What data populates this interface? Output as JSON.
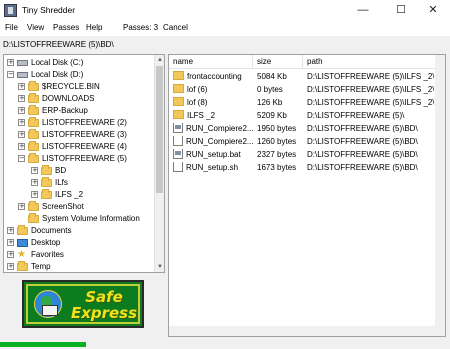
{
  "window": {
    "title": "Tiny Shredder",
    "minimize": "—",
    "maximize": "☐",
    "close": "✕"
  },
  "menu": {
    "file": "File",
    "view": "View",
    "passes": "Passes",
    "help": "Help",
    "passes_count": "Passes: 3",
    "cancel": "Cancel"
  },
  "current_path": "D:\\LISTOFFREEWARE (5)\\BD\\",
  "tree": [
    {
      "label": "Local Disk (C:)",
      "icon": "drive-icon",
      "expander": "+"
    },
    {
      "label": "Local Disk (D:)",
      "icon": "drive-icon",
      "expander": "−"
    },
    {
      "label": "$RECYCLE.BIN",
      "icon": "folder-icon",
      "expander": "+"
    },
    {
      "label": "DOWNLOADS",
      "icon": "folder-icon",
      "expander": "+"
    },
    {
      "label": "ERP-Backup",
      "icon": "folder-icon",
      "expander": "+"
    },
    {
      "label": "LISTOFFREEWARE (2)",
      "icon": "folder-icon",
      "expander": "+"
    },
    {
      "label": "LISTOFFREEWARE (3)",
      "icon": "folder-icon",
      "expander": "+"
    },
    {
      "label": "LISTOFFREEWARE (4)",
      "icon": "folder-icon",
      "expander": "+"
    },
    {
      "label": "LISTOFFREEWARE (5)",
      "icon": "folder-icon",
      "expander": "−"
    },
    {
      "label": "BD",
      "icon": "folder-icon",
      "expander": "+"
    },
    {
      "label": "ILfs",
      "icon": "folder-icon",
      "expander": "+"
    },
    {
      "label": "ILFS _2",
      "icon": "folder-icon",
      "expander": "+"
    },
    {
      "label": "ScreenShot",
      "icon": "folder-icon",
      "expander": "+"
    },
    {
      "label": "System Volume Information",
      "icon": "folder-icon",
      "expander": ""
    },
    {
      "label": "Documents",
      "icon": "folder-icon",
      "expander": "+"
    },
    {
      "label": "Desktop",
      "icon": "desktop-icon",
      "expander": "+"
    },
    {
      "label": "Favorites",
      "icon": "star-icon",
      "expander": "+"
    },
    {
      "label": "Temp",
      "icon": "folder-icon",
      "expander": "+"
    }
  ],
  "logo": {
    "line1": "Safe",
    "line2": "Express"
  },
  "columns": {
    "name": "name",
    "size": "size",
    "path": "path"
  },
  "files": [
    {
      "name": "frontaccounting",
      "size": "5084 Kb",
      "path": "D:\\LISTOFFREEWARE (5)\\ILFS _2\\",
      "type": "folder"
    },
    {
      "name": "lof (6)",
      "size": "0 bytes",
      "path": "D:\\LISTOFFREEWARE (5)\\ILFS _2\\",
      "type": "folder"
    },
    {
      "name": "lof (8)",
      "size": "126 Kb",
      "path": "D:\\LISTOFFREEWARE (5)\\ILFS _2\\",
      "type": "folder"
    },
    {
      "name": "ILFS _2",
      "size": "5209 Kb",
      "path": "D:\\LISTOFFREEWARE (5)\\",
      "type": "folder"
    },
    {
      "name": "RUN_Compiere2...",
      "size": "1950 bytes",
      "path": "D:\\LISTOFFREEWARE (5)\\BD\\",
      "type": "bat"
    },
    {
      "name": "RUN_Compiere2...",
      "size": "1260 bytes",
      "path": "D:\\LISTOFFREEWARE (5)\\BD\\",
      "type": "file"
    },
    {
      "name": "RUN_setup.bat",
      "size": "2327 bytes",
      "path": "D:\\LISTOFFREEWARE (5)\\BD\\",
      "type": "bat"
    },
    {
      "name": "RUN_setup.sh",
      "size": "1673 bytes",
      "path": "D:\\LISTOFFREEWARE (5)\\BD\\",
      "type": "file"
    }
  ],
  "progress": {
    "fraction": 0.19,
    "color": "#06b025"
  }
}
